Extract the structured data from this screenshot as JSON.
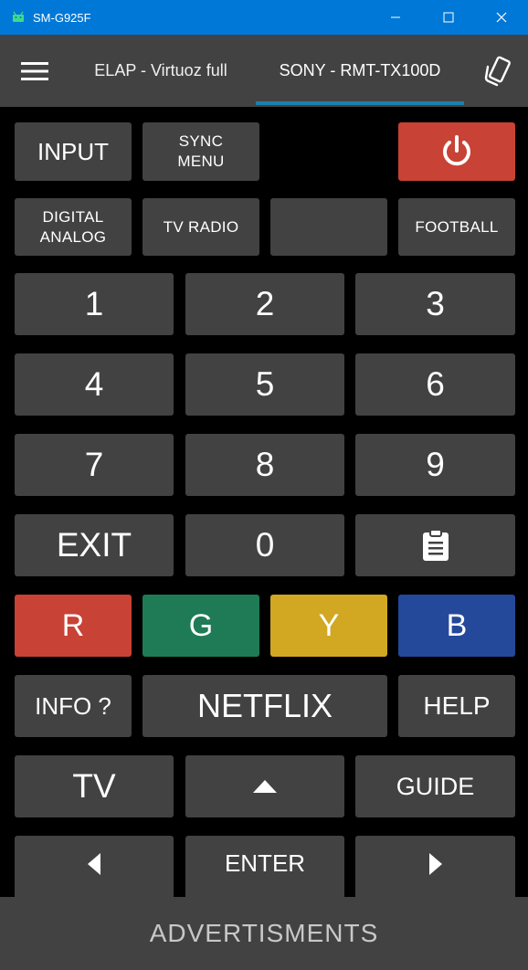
{
  "window": {
    "title": "SM-G925F"
  },
  "appbar": {
    "tabs": [
      {
        "label": "ELAP - Virtuoz full"
      },
      {
        "label": "SONY - RMT-TX100D"
      }
    ]
  },
  "remote": {
    "row1": {
      "input": "INPUT",
      "sync_menu": "SYNC\nMENU"
    },
    "row2": {
      "digital_analog": "DIGITAL\nANALOG",
      "tv_radio": "TV RADIO",
      "blank": "",
      "football": "FOOTBALL"
    },
    "digits": [
      "1",
      "2",
      "3",
      "4",
      "5",
      "6",
      "7",
      "8",
      "9"
    ],
    "row_exit": {
      "exit": "EXIT",
      "zero": "0"
    },
    "colors": {
      "r": "R",
      "g": "G",
      "y": "Y",
      "b": "B"
    },
    "row_info": {
      "info": "INFO ?",
      "netflix": "NETFLIX",
      "help": "HELP"
    },
    "row_tv": {
      "tv": "TV",
      "guide": "GUIDE"
    },
    "row_nav": {
      "enter": "ENTER"
    }
  },
  "footer": {
    "ads": "ADVERTISMENTS"
  },
  "colors": {
    "titlebar": "#0078d7",
    "button": "#424242",
    "power": "#c84235",
    "red": "#c84235",
    "green": "#1e7b55",
    "yellow": "#d2a823",
    "blue": "#24499a",
    "accent_underline": "#1c7fae"
  },
  "icons": {
    "app": "android-icon",
    "menu": "hamburger-menu-icon",
    "device": "switch-device-icon",
    "power": "power-icon",
    "clipboard": "clipboard-icon",
    "up": "triangle-up-icon",
    "left": "triangle-left-icon",
    "right": "triangle-right-icon"
  }
}
